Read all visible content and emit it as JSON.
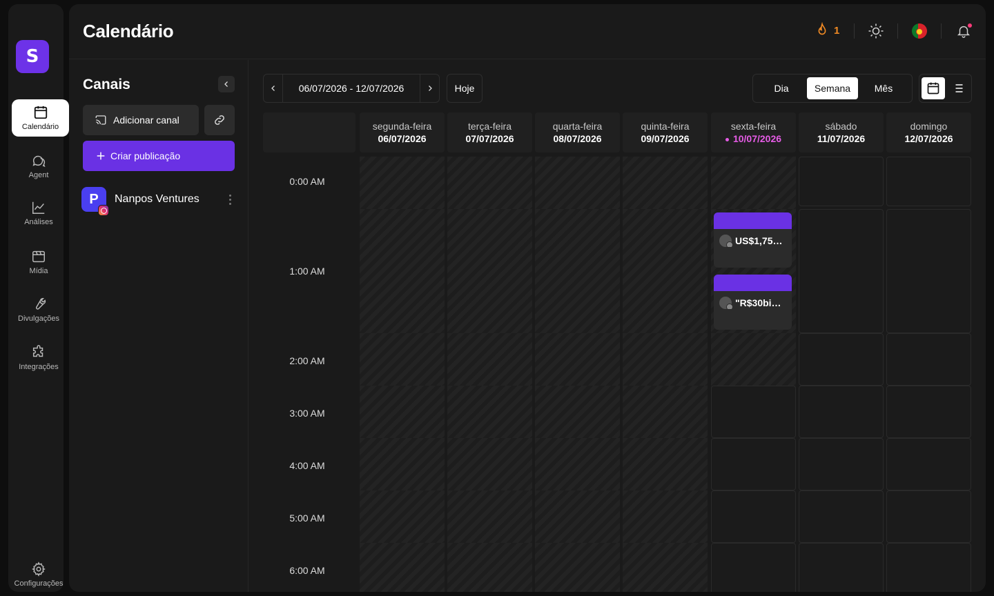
{
  "app": {
    "logo_letter": "S"
  },
  "nav": {
    "items": [
      {
        "label": "Calendário",
        "icon": "calendar-icon"
      },
      {
        "label": "Agent",
        "icon": "chat-icon"
      },
      {
        "label": "Análises",
        "icon": "chart-icon"
      },
      {
        "label": "Mídia",
        "icon": "media-icon"
      },
      {
        "label": "Divulgações",
        "icon": "wrench-icon"
      },
      {
        "label": "Integrações",
        "icon": "puzzle-icon"
      }
    ],
    "settings_label": "Configurações"
  },
  "header": {
    "title": "Calendário",
    "streak_count": "1"
  },
  "channels": {
    "title": "Canais",
    "add_label": "Adicionar canal",
    "create_label": "Criar publicação",
    "list": [
      {
        "name": "Nanpos Ventures",
        "avatar_letter": "P"
      }
    ]
  },
  "toolbar": {
    "range": "06/07/2026 - 12/07/2026",
    "today_label": "Hoje",
    "views": [
      "Dia",
      "Semana",
      "Mês"
    ],
    "active_view": "Semana"
  },
  "week": {
    "days": [
      {
        "name": "segunda-feira",
        "date": "06/07/2026"
      },
      {
        "name": "terça-feira",
        "date": "07/07/2026"
      },
      {
        "name": "quarta-feira",
        "date": "08/07/2026"
      },
      {
        "name": "quinta-feira",
        "date": "09/07/2026"
      },
      {
        "name": "sexta-feira",
        "date": "10/07/2026",
        "today": true
      },
      {
        "name": "sábado",
        "date": "11/07/2026"
      },
      {
        "name": "domingo",
        "date": "12/07/2026"
      }
    ],
    "times": [
      "0:00 AM",
      "1:00 AM",
      "2:00 AM",
      "3:00 AM",
      "4:00 AM",
      "5:00 AM",
      "6:00 AM"
    ]
  },
  "events": [
    {
      "day": "sexta-feira",
      "time": "1:00 AM",
      "text": "US$1,75…"
    },
    {
      "day": "sexta-feira",
      "time": "1:00 AM",
      "text": "\"R$30bi…"
    }
  ],
  "colors": {
    "accent": "#6a31e4",
    "today": "#e65ce6",
    "streak": "#f08a24"
  }
}
